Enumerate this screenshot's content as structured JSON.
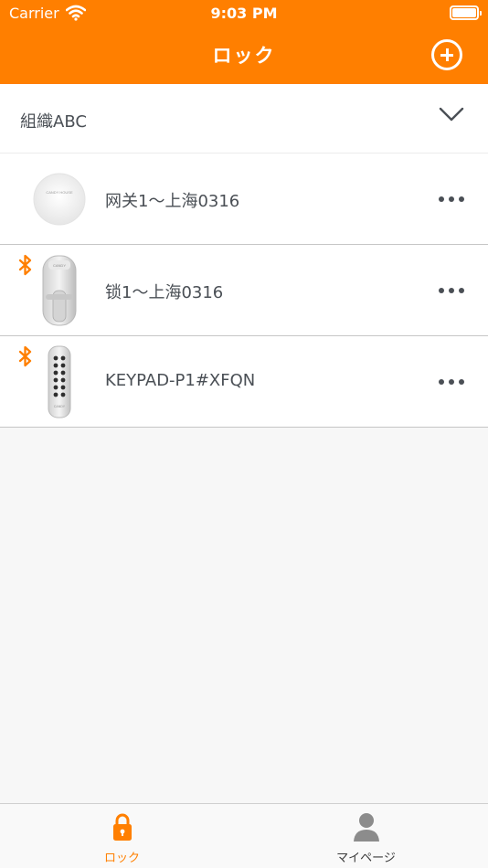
{
  "status_bar": {
    "carrier": "Carrier",
    "time": "9:03 PM",
    "wifi_icon": "wifi-icon",
    "battery_icon": "battery-icon",
    "battery_level": 1.0
  },
  "navbar": {
    "title": "ロック",
    "add_icon": "plus-circle-icon",
    "bg_color": "#ff7f00"
  },
  "organization": {
    "name": "組織ABC",
    "expand_icon": "chevron-down-icon"
  },
  "devices": [
    {
      "name": "网关1～上海0316",
      "type": "gateway",
      "bluetooth": false,
      "thumb_text": "CANDY HOUSE",
      "more_icon": "more-horizontal-icon"
    },
    {
      "name": "锁1～上海0316",
      "type": "lock",
      "bluetooth": true,
      "thumb_text": "CANDY",
      "more_icon": "more-horizontal-icon"
    },
    {
      "name": "KEYPAD-P1#XFQN",
      "type": "keypad",
      "bluetooth": true,
      "thumb_text": "CANDY",
      "more_icon": "more-horizontal-icon"
    }
  ],
  "tab_bar": {
    "tabs": [
      {
        "label": "ロック",
        "icon": "lock-icon",
        "active": true
      },
      {
        "label": "マイページ",
        "icon": "person-icon",
        "active": false
      }
    ]
  },
  "colors": {
    "accent": "#ff7f00",
    "bluetooth": "#ff7f00",
    "text": "#4a4f55"
  }
}
